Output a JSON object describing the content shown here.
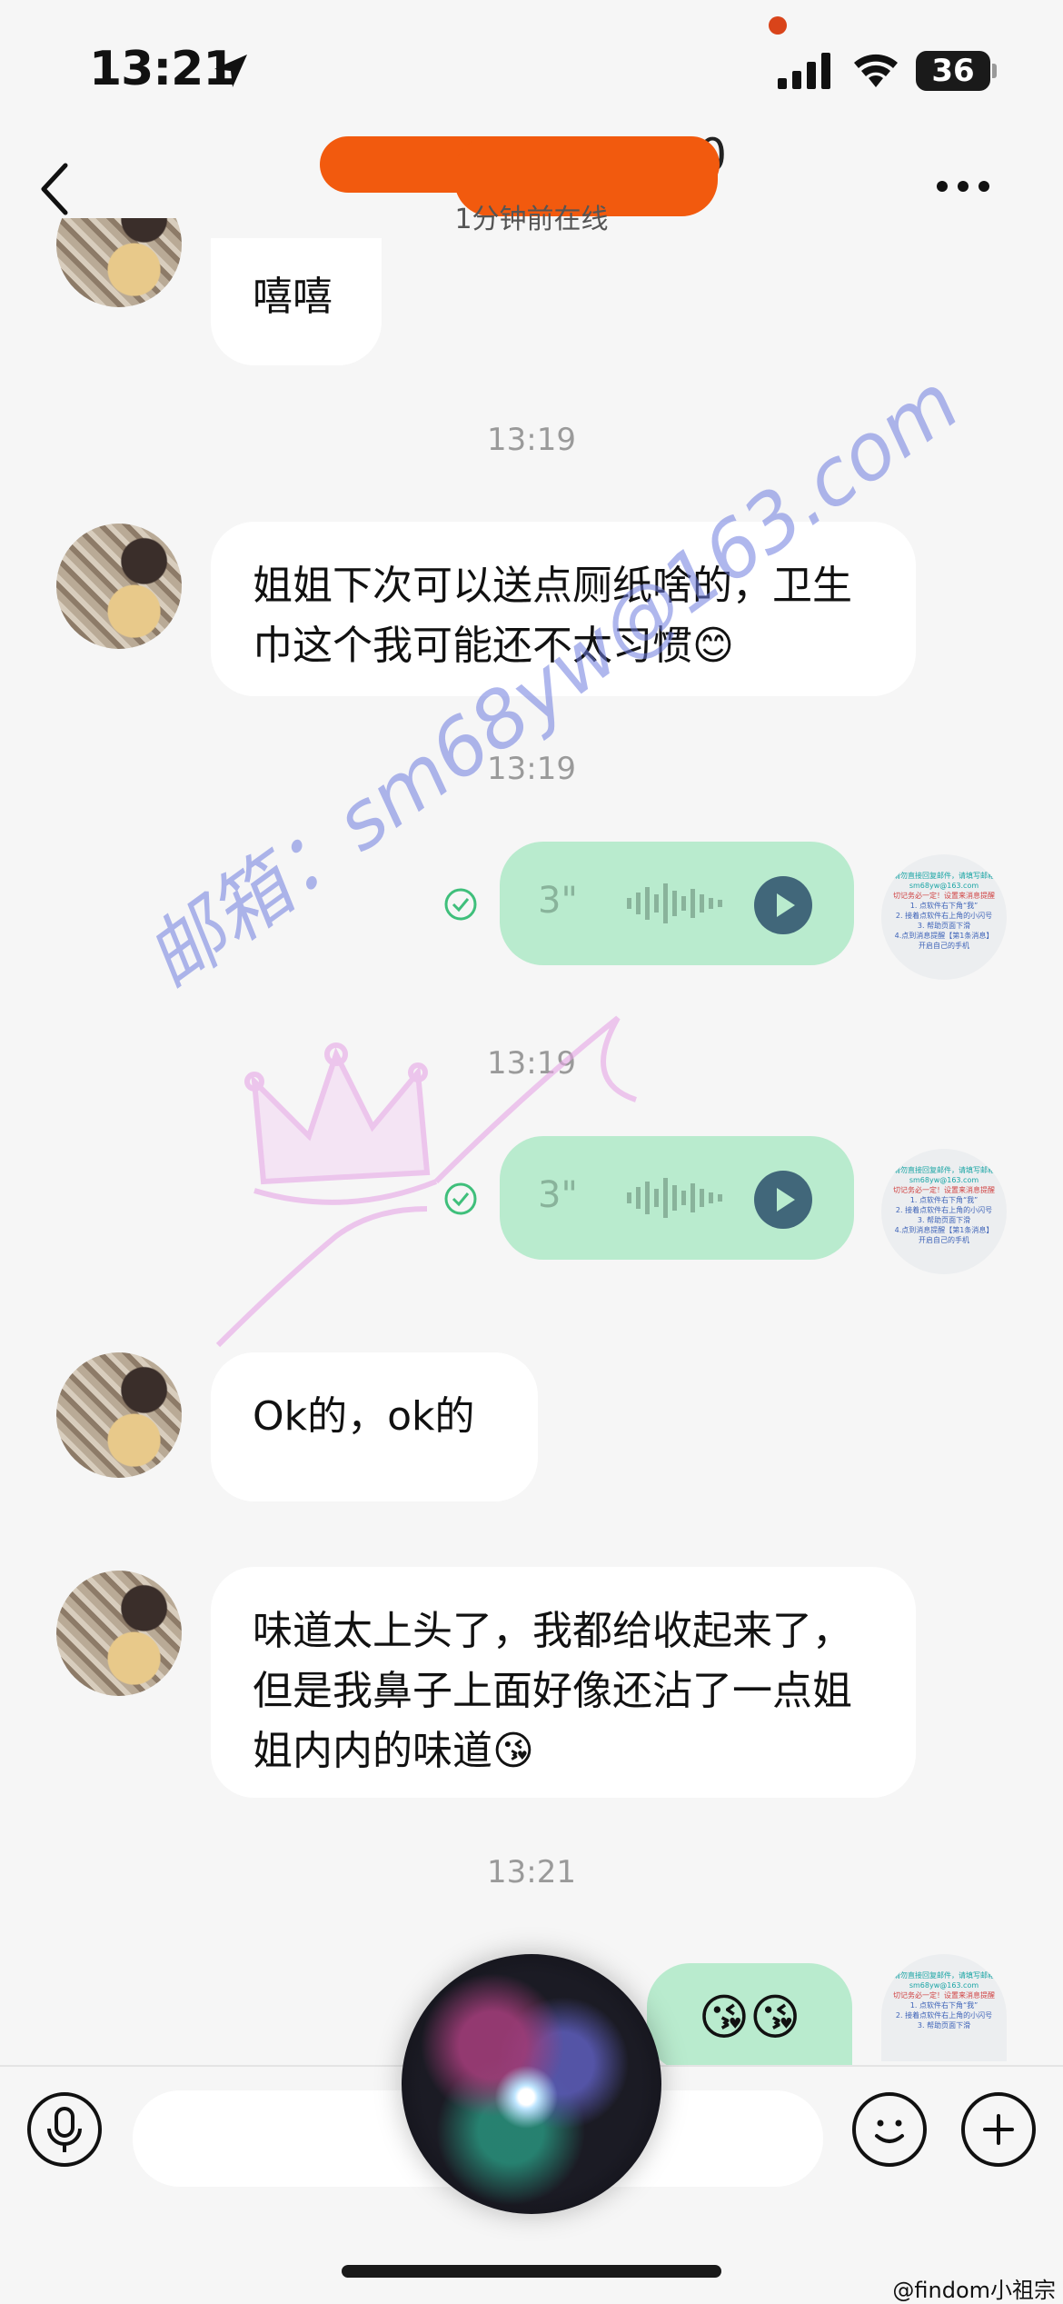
{
  "status_bar": {
    "time": "13:21",
    "battery": "36"
  },
  "header": {
    "contact_name": "0",
    "subtitle": "1分钟前在线"
  },
  "messages": [
    {
      "side": "left",
      "type": "text",
      "text": "嘻嘻"
    },
    {
      "type": "timestamp",
      "text": "13:19"
    },
    {
      "side": "left",
      "type": "text",
      "text": "姐姐下次可以送点厕纸啥的，卫生巾这个我可能还不太习惯😊"
    },
    {
      "type": "timestamp",
      "text": "13:19"
    },
    {
      "side": "right",
      "type": "voice",
      "duration": "3\""
    },
    {
      "type": "timestamp",
      "text": "13:19"
    },
    {
      "side": "right",
      "type": "voice",
      "duration": "3\""
    },
    {
      "side": "left",
      "type": "text",
      "text": "Ok的，ok的"
    },
    {
      "side": "left",
      "type": "text",
      "text": "味道太上头了，我都给收起来了，但是我鼻子上面好像还沾了一点姐姐内内的味道😘"
    },
    {
      "type": "timestamp",
      "text": "13:21"
    },
    {
      "side": "right",
      "type": "text",
      "text": "😘😘"
    }
  ],
  "self_avatar_lines": [
    "请勿直接回复邮件，请填写邮箱",
    "sm68yw@163.com",
    "切记务必一定！设置来消息提醒",
    "1. 点软件右下角“我”",
    "2. 接着点软件右上角的小闪号",
    "3. 帮助页面下滑",
    "4.点到消息提醒【第1条消息】",
    "开启自己的手机"
  ],
  "watermark": {
    "text": "邮箱：sm68yw@163.com"
  },
  "footer_credit": "@findom小祖宗",
  "colors": {
    "background": "#f6f6f6",
    "bubble_self": "#b9ebce",
    "bubble_other": "#ffffff",
    "redaction": "#f25a0e",
    "play_button": "#41677a"
  },
  "icons": [
    "location-arrow-icon",
    "signal-icon",
    "wifi-icon",
    "back-icon",
    "more-icon",
    "check-circle-icon",
    "play-icon",
    "microphone-icon",
    "emoji-icon",
    "plus-icon"
  ]
}
